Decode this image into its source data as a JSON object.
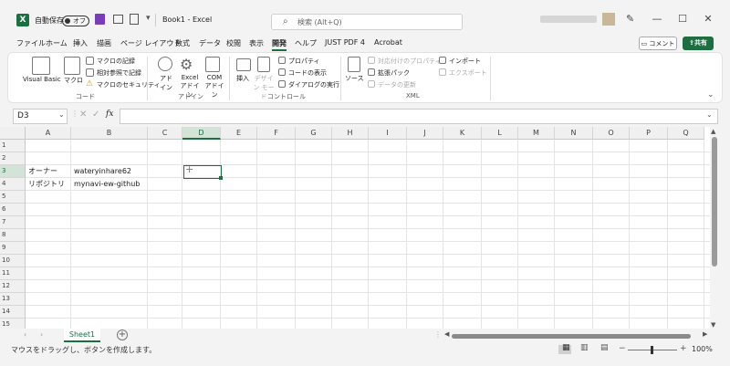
{
  "titlebar": {
    "autosave_label": "自動保存",
    "autosave_state": "オフ",
    "doc_title": "Book1 - Excel",
    "search_placeholder": "検索 (Alt+Q)",
    "minimize": "—",
    "maximize": "☐",
    "close": "✕"
  },
  "menu": {
    "items": [
      "ファイル",
      "ホーム",
      "挿入",
      "描画",
      "ページ レイアウト",
      "数式",
      "データ",
      "校閲",
      "表示",
      "開発",
      "ヘルプ",
      "JUST PDF 4",
      "Acrobat"
    ],
    "active": "開発",
    "comment": "コメント",
    "share": "共有"
  },
  "ribbon": {
    "code": {
      "visual_basic": "Visual Basic",
      "macro": "マクロ",
      "record": "マクロの記録",
      "relative": "相対参照で記録",
      "security": "マクロのセキュリティ",
      "group": "コード"
    },
    "addin": {
      "addin": "アド イン",
      "excel_addin": "Excel アドイン",
      "com_addin": "COM アドイン",
      "group": "アドイン"
    },
    "controls": {
      "insert": "挿入",
      "design_mode": "デザイン モード",
      "properties": "プロパティ",
      "view_code": "コードの表示",
      "run_dialog": "ダイアログの実行",
      "group": "コントロール"
    },
    "xml": {
      "source": "ソース",
      "map_properties": "対応付けのプロパティ",
      "expansion_pack": "拡張パック",
      "refresh_data": "データの更新",
      "import": "インポート",
      "export": "エクスポート",
      "group": "XML"
    }
  },
  "formula_bar": {
    "name_box": "D3",
    "fx": "fx",
    "value": ""
  },
  "grid": {
    "columns": [
      "A",
      "B",
      "C",
      "D",
      "E",
      "F",
      "G",
      "H",
      "I",
      "J",
      "K",
      "L",
      "M",
      "N",
      "O",
      "P",
      "Q"
    ],
    "rows": [
      "1",
      "2",
      "3",
      "4",
      "5",
      "6",
      "7",
      "8",
      "9",
      "10",
      "11",
      "12",
      "13",
      "14",
      "15"
    ],
    "selected_column": "D",
    "selected_row": "3",
    "cells": {
      "A3": "オーナー",
      "B3": "wateryinhare62",
      "A4": "リポジトリ",
      "B4": "mynavi-ew-github"
    }
  },
  "sheets": {
    "tabs": [
      "Sheet1"
    ],
    "add": "+"
  },
  "status": {
    "message": "マウスをドラッグし、ボタンを作成します。",
    "zoom": "100%",
    "zoom_minus": "−",
    "zoom_plus": "+"
  },
  "colors": {
    "accent": "#1d6f42"
  }
}
